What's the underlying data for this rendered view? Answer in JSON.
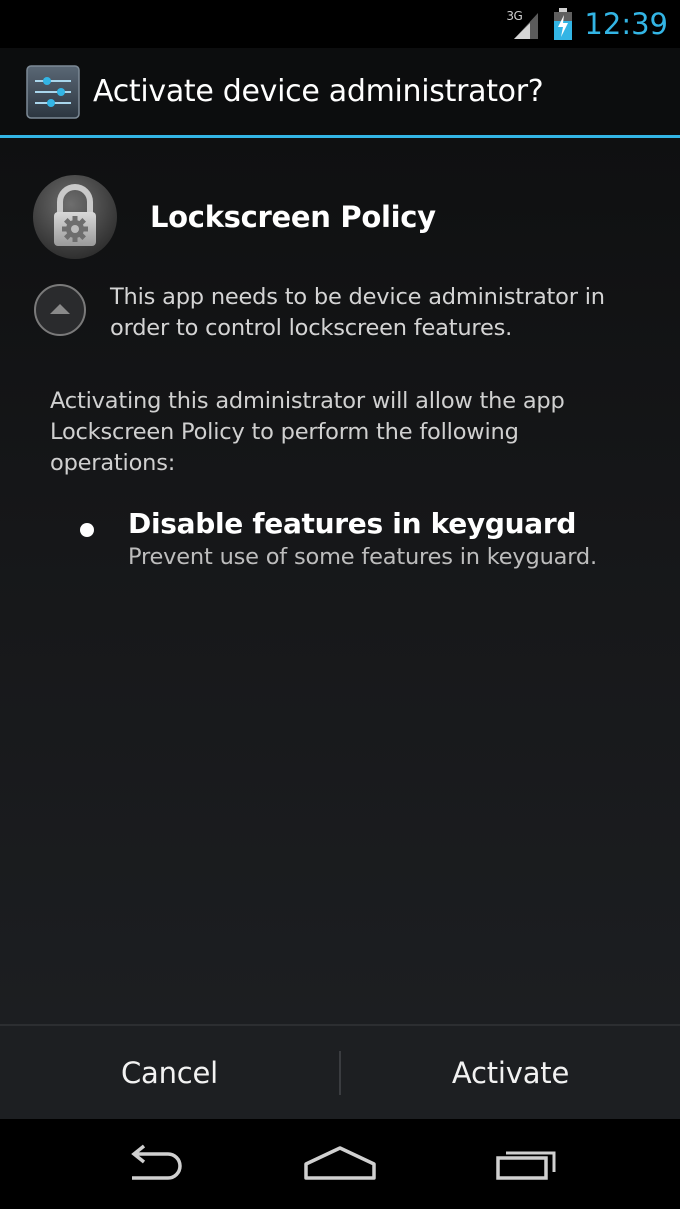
{
  "status_bar": {
    "network": "3G",
    "time": "12:39",
    "icons": [
      "signal-icon",
      "battery-icon"
    ]
  },
  "dialog": {
    "title": "Activate device administrator?",
    "title_icon": "settings-sliders-icon",
    "app": {
      "name": "Lockscreen Policy",
      "icon": "lock-gear-icon"
    },
    "description": "This app needs to be device administrator in order to control lockscreen features.",
    "activating_text": "Activating this administrator will allow the app Lockscreen Policy to perform the following operations:",
    "policies": [
      {
        "title": "Disable features in keyguard",
        "description": "Prevent use of some features in keyguard."
      }
    ],
    "buttons": {
      "cancel": "Cancel",
      "activate": "Activate"
    }
  },
  "nav_bar": {
    "icons": [
      "back-icon",
      "home-icon",
      "recent-apps-icon"
    ]
  },
  "colors": {
    "accent": "#33b5e5",
    "background": "#000000",
    "button_bar": "#1d1f22"
  }
}
